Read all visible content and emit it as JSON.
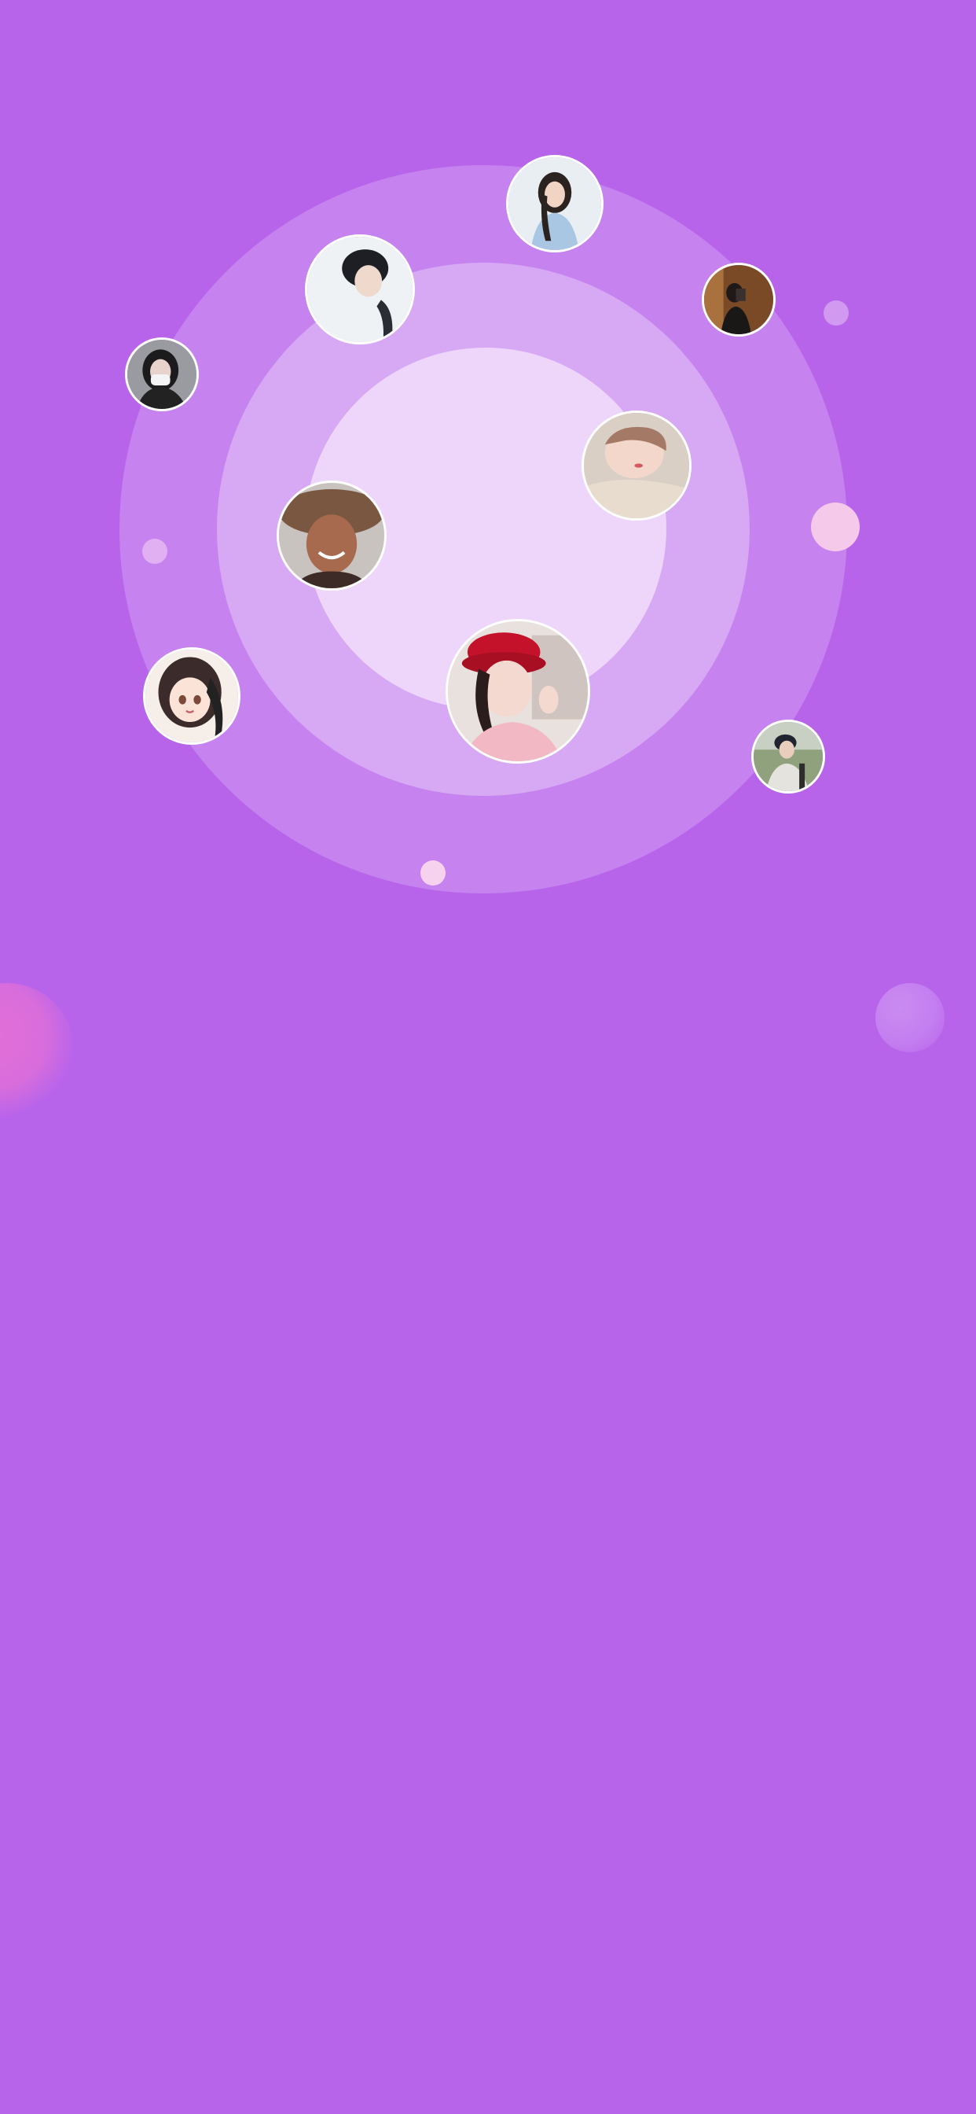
{
  "colors": {
    "background": "#b864ea",
    "ring_outer": "#c682ef",
    "ring_middle": "#d7a8f4",
    "ring_inner": "#eed6fb",
    "avatar_border": "#ffffff",
    "accent_pink": "#f5c9ea"
  },
  "avatars": [
    {
      "name": "avatar-woman-light-blue-shirt"
    },
    {
      "name": "avatar-man-head-down"
    },
    {
      "name": "avatar-person-mirror-selfie"
    },
    {
      "name": "avatar-woman-face-mask"
    },
    {
      "name": "avatar-child-sleeping"
    },
    {
      "name": "avatar-woman-straw-hat"
    },
    {
      "name": "avatar-anime-girl"
    },
    {
      "name": "avatar-woman-red-hat"
    },
    {
      "name": "avatar-man-outdoors"
    }
  ]
}
